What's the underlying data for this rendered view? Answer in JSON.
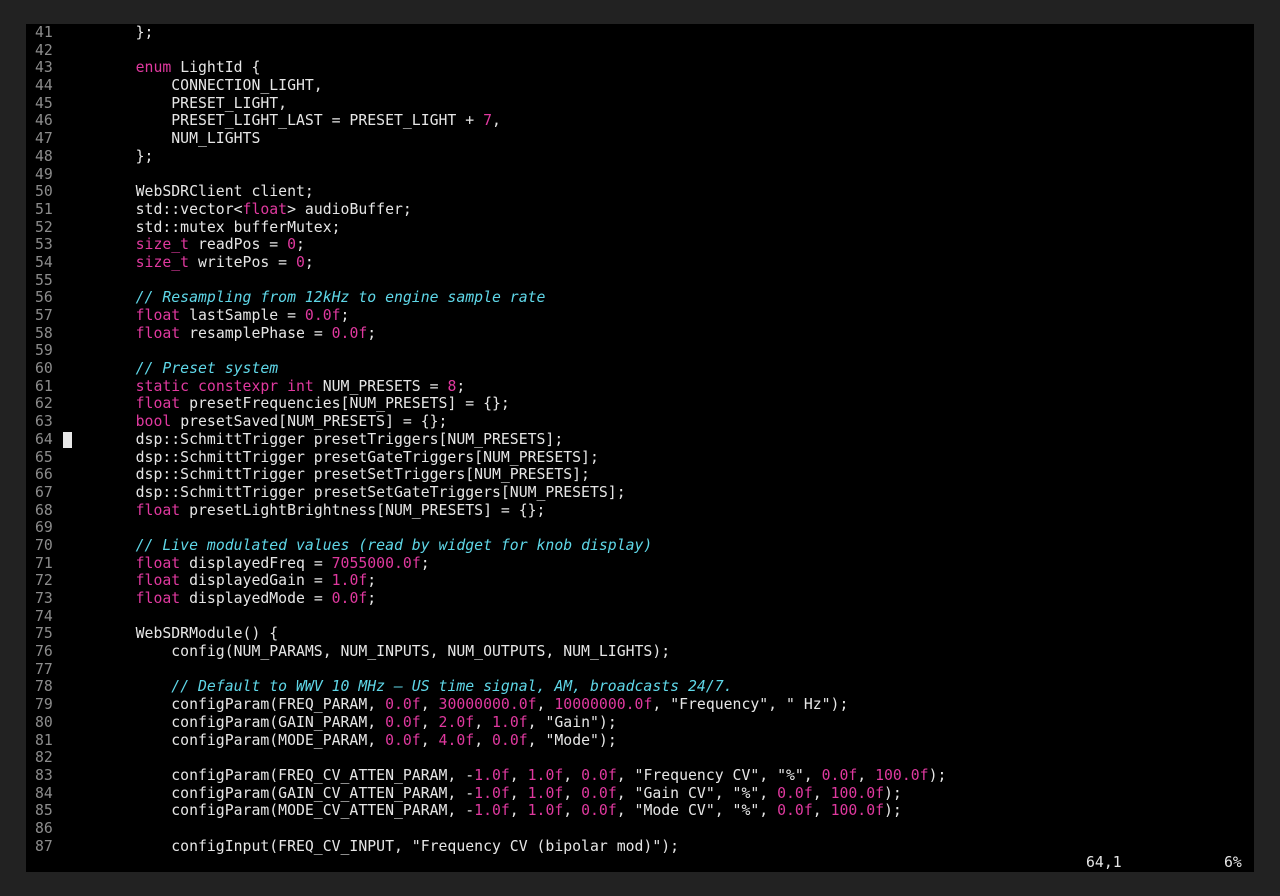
{
  "editor": {
    "cursor_line": 64,
    "lines": [
      {
        "n": "41",
        "t": [
          [
            "plain",
            "    };"
          ]
        ]
      },
      {
        "n": "42",
        "t": []
      },
      {
        "n": "43",
        "t": [
          [
            "plain",
            "    "
          ],
          [
            "kw",
            "enum"
          ],
          [
            "plain",
            " LightId {"
          ]
        ]
      },
      {
        "n": "44",
        "t": [
          [
            "plain",
            "        CONNECTION_LIGHT,"
          ]
        ]
      },
      {
        "n": "45",
        "t": [
          [
            "plain",
            "        PRESET_LIGHT,"
          ]
        ]
      },
      {
        "n": "46",
        "t": [
          [
            "plain",
            "        PRESET_LIGHT_LAST = PRESET_LIGHT + "
          ],
          [
            "num",
            "7"
          ],
          [
            "plain",
            ","
          ]
        ]
      },
      {
        "n": "47",
        "t": [
          [
            "plain",
            "        NUM_LIGHTS"
          ]
        ]
      },
      {
        "n": "48",
        "t": [
          [
            "plain",
            "    };"
          ]
        ]
      },
      {
        "n": "49",
        "t": []
      },
      {
        "n": "50",
        "t": [
          [
            "plain",
            "    WebSDRClient client;"
          ]
        ]
      },
      {
        "n": "51",
        "t": [
          [
            "plain",
            "    std::vector<"
          ],
          [
            "type",
            "float"
          ],
          [
            "plain",
            "> audioBuffer;"
          ]
        ]
      },
      {
        "n": "52",
        "t": [
          [
            "plain",
            "    std::mutex bufferMutex;"
          ]
        ]
      },
      {
        "n": "53",
        "t": [
          [
            "plain",
            "    "
          ],
          [
            "type",
            "size_t"
          ],
          [
            "plain",
            " readPos = "
          ],
          [
            "num",
            "0"
          ],
          [
            "plain",
            ";"
          ]
        ]
      },
      {
        "n": "54",
        "t": [
          [
            "plain",
            "    "
          ],
          [
            "type",
            "size_t"
          ],
          [
            "plain",
            " writePos = "
          ],
          [
            "num",
            "0"
          ],
          [
            "plain",
            ";"
          ]
        ]
      },
      {
        "n": "55",
        "t": []
      },
      {
        "n": "56",
        "t": [
          [
            "plain",
            "    "
          ],
          [
            "comment",
            "// Resampling from 12kHz to engine sample rate"
          ]
        ]
      },
      {
        "n": "57",
        "t": [
          [
            "plain",
            "    "
          ],
          [
            "type",
            "float"
          ],
          [
            "plain",
            " lastSample = "
          ],
          [
            "num",
            "0.0f"
          ],
          [
            "plain",
            ";"
          ]
        ]
      },
      {
        "n": "58",
        "t": [
          [
            "plain",
            "    "
          ],
          [
            "type",
            "float"
          ],
          [
            "plain",
            " resamplePhase = "
          ],
          [
            "num",
            "0.0f"
          ],
          [
            "plain",
            ";"
          ]
        ]
      },
      {
        "n": "59",
        "t": []
      },
      {
        "n": "60",
        "t": [
          [
            "plain",
            "    "
          ],
          [
            "comment",
            "// Preset system"
          ]
        ]
      },
      {
        "n": "61",
        "t": [
          [
            "plain",
            "    "
          ],
          [
            "kw",
            "static constexpr int"
          ],
          [
            "plain",
            " NUM_PRESETS = "
          ],
          [
            "num",
            "8"
          ],
          [
            "plain",
            ";"
          ]
        ]
      },
      {
        "n": "62",
        "t": [
          [
            "plain",
            "    "
          ],
          [
            "type",
            "float"
          ],
          [
            "plain",
            " presetFrequencies[NUM_PRESETS] = {};"
          ]
        ]
      },
      {
        "n": "63",
        "t": [
          [
            "plain",
            "    "
          ],
          [
            "type",
            "bool"
          ],
          [
            "plain",
            " presetSaved[NUM_PRESETS] = {};"
          ]
        ]
      },
      {
        "n": "64",
        "t": [
          [
            "plain",
            "    dsp::SchmittTrigger presetTriggers[NUM_PRESETS];"
          ]
        ]
      },
      {
        "n": "65",
        "t": [
          [
            "plain",
            "    dsp::SchmittTrigger presetGateTriggers[NUM_PRESETS];"
          ]
        ]
      },
      {
        "n": "66",
        "t": [
          [
            "plain",
            "    dsp::SchmittTrigger presetSetTriggers[NUM_PRESETS];"
          ]
        ]
      },
      {
        "n": "67",
        "t": [
          [
            "plain",
            "    dsp::SchmittTrigger presetSetGateTriggers[NUM_PRESETS];"
          ]
        ]
      },
      {
        "n": "68",
        "t": [
          [
            "plain",
            "    "
          ],
          [
            "type",
            "float"
          ],
          [
            "plain",
            " presetLightBrightness[NUM_PRESETS] = {};"
          ]
        ]
      },
      {
        "n": "69",
        "t": []
      },
      {
        "n": "70",
        "t": [
          [
            "plain",
            "    "
          ],
          [
            "comment",
            "// Live modulated values (read by widget for knob display)"
          ]
        ]
      },
      {
        "n": "71",
        "t": [
          [
            "plain",
            "    "
          ],
          [
            "type",
            "float"
          ],
          [
            "plain",
            " displayedFreq = "
          ],
          [
            "num",
            "7055000.0f"
          ],
          [
            "plain",
            ";"
          ]
        ]
      },
      {
        "n": "72",
        "t": [
          [
            "plain",
            "    "
          ],
          [
            "type",
            "float"
          ],
          [
            "plain",
            " displayedGain = "
          ],
          [
            "num",
            "1.0f"
          ],
          [
            "plain",
            ";"
          ]
        ]
      },
      {
        "n": "73",
        "t": [
          [
            "plain",
            "    "
          ],
          [
            "type",
            "float"
          ],
          [
            "plain",
            " displayedMode = "
          ],
          [
            "num",
            "0.0f"
          ],
          [
            "plain",
            ";"
          ]
        ]
      },
      {
        "n": "74",
        "t": []
      },
      {
        "n": "75",
        "t": [
          [
            "plain",
            "    WebSDRModule() {"
          ]
        ]
      },
      {
        "n": "76",
        "t": [
          [
            "plain",
            "        config(NUM_PARAMS, NUM_INPUTS, NUM_OUTPUTS, NUM_LIGHTS);"
          ]
        ]
      },
      {
        "n": "77",
        "t": []
      },
      {
        "n": "78",
        "t": [
          [
            "plain",
            "        "
          ],
          [
            "comment",
            "// Default to WWV 10 MHz — US time signal, AM, broadcasts 24/7."
          ]
        ]
      },
      {
        "n": "79",
        "t": [
          [
            "plain",
            "        configParam(FREQ_PARAM, "
          ],
          [
            "num",
            "0.0f"
          ],
          [
            "plain",
            ", "
          ],
          [
            "num",
            "30000000.0f"
          ],
          [
            "plain",
            ", "
          ],
          [
            "num",
            "10000000.0f"
          ],
          [
            "plain",
            ", \"Frequency\", \" Hz\");"
          ]
        ]
      },
      {
        "n": "80",
        "t": [
          [
            "plain",
            "        configParam(GAIN_PARAM, "
          ],
          [
            "num",
            "0.0f"
          ],
          [
            "plain",
            ", "
          ],
          [
            "num",
            "2.0f"
          ],
          [
            "plain",
            ", "
          ],
          [
            "num",
            "1.0f"
          ],
          [
            "plain",
            ", \"Gain\");"
          ]
        ]
      },
      {
        "n": "81",
        "t": [
          [
            "plain",
            "        configParam(MODE_PARAM, "
          ],
          [
            "num",
            "0.0f"
          ],
          [
            "plain",
            ", "
          ],
          [
            "num",
            "4.0f"
          ],
          [
            "plain",
            ", "
          ],
          [
            "num",
            "0.0f"
          ],
          [
            "plain",
            ", \"Mode\");"
          ]
        ]
      },
      {
        "n": "82",
        "t": []
      },
      {
        "n": "83",
        "t": [
          [
            "plain",
            "        configParam(FREQ_CV_ATTEN_PARAM, -"
          ],
          [
            "num",
            "1.0f"
          ],
          [
            "plain",
            ", "
          ],
          [
            "num",
            "1.0f"
          ],
          [
            "plain",
            ", "
          ],
          [
            "num",
            "0.0f"
          ],
          [
            "plain",
            ", \"Frequency CV\", \"%\", "
          ],
          [
            "num",
            "0.0f"
          ],
          [
            "plain",
            ", "
          ],
          [
            "num",
            "100.0f"
          ],
          [
            "plain",
            ");"
          ]
        ]
      },
      {
        "n": "84",
        "t": [
          [
            "plain",
            "        configParam(GAIN_CV_ATTEN_PARAM, -"
          ],
          [
            "num",
            "1.0f"
          ],
          [
            "plain",
            ", "
          ],
          [
            "num",
            "1.0f"
          ],
          [
            "plain",
            ", "
          ],
          [
            "num",
            "0.0f"
          ],
          [
            "plain",
            ", \"Gain CV\", \"%\", "
          ],
          [
            "num",
            "0.0f"
          ],
          [
            "plain",
            ", "
          ],
          [
            "num",
            "100.0f"
          ],
          [
            "plain",
            ");"
          ]
        ]
      },
      {
        "n": "85",
        "t": [
          [
            "plain",
            "        configParam(MODE_CV_ATTEN_PARAM, -"
          ],
          [
            "num",
            "1.0f"
          ],
          [
            "plain",
            ", "
          ],
          [
            "num",
            "1.0f"
          ],
          [
            "plain",
            ", "
          ],
          [
            "num",
            "0.0f"
          ],
          [
            "plain",
            ", \"Mode CV\", \"%\", "
          ],
          [
            "num",
            "0.0f"
          ],
          [
            "plain",
            ", "
          ],
          [
            "num",
            "100.0f"
          ],
          [
            "plain",
            ");"
          ]
        ]
      },
      {
        "n": "86",
        "t": []
      },
      {
        "n": "87",
        "t": [
          [
            "plain",
            "        configInput(FREQ_CV_INPUT, \"Frequency CV (bipolar mod)\");"
          ]
        ]
      }
    ]
  },
  "statusline": {
    "position": "64,1",
    "scroll_percent": "6%"
  }
}
